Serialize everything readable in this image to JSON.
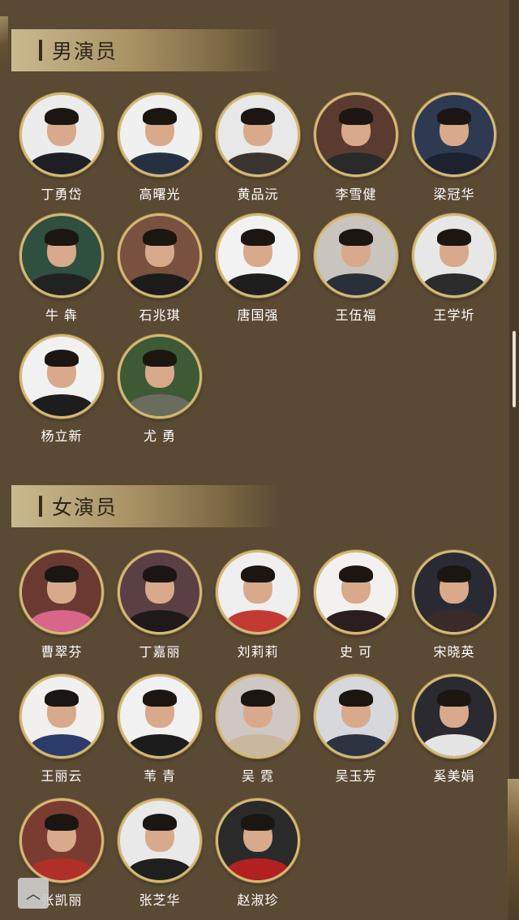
{
  "sections": [
    {
      "title": "男演员",
      "people": [
        {
          "name": "丁勇岱",
          "bg": "#ececec",
          "shirt": "#1d1f24"
        },
        {
          "name": "高曙光",
          "bg": "#f0f0f0",
          "shirt": "#263041"
        },
        {
          "name": "黄品沅",
          "bg": "#e8e8e8",
          "shirt": "#3a3530"
        },
        {
          "name": "李雪健",
          "bg": "#5b3a30",
          "shirt": "#2a2a2a"
        },
        {
          "name": "梁冠华",
          "bg": "#2e3a52",
          "shirt": "#1c2230"
        },
        {
          "name": "牛 犇",
          "bg": "#2f4f3f",
          "shirt": "#222"
        },
        {
          "name": "石兆琪",
          "bg": "#7a5040",
          "shirt": "#1c1c1c"
        },
        {
          "name": "唐国强",
          "bg": "#f2f2f2",
          "shirt": "#1e1e1e"
        },
        {
          "name": "王伍福",
          "bg": "#c9c4be",
          "shirt": "#2b2f3a"
        },
        {
          "name": "王学圻",
          "bg": "#e7e7e7",
          "shirt": "#2c2c2c"
        },
        {
          "name": "杨立新",
          "bg": "#f1f1f1",
          "shirt": "#1d1d1d"
        },
        {
          "name": "尤 勇",
          "bg": "#3e5a34",
          "shirt": "#6a6d5e"
        }
      ]
    },
    {
      "title": "女演员",
      "people": [
        {
          "name": "曹翠芬",
          "bg": "#6a3a32",
          "shirt": "#d7668a"
        },
        {
          "name": "丁嘉丽",
          "bg": "#5a3f45",
          "shirt": "#1e1a1a"
        },
        {
          "name": "刘莉莉",
          "bg": "#f0efef",
          "shirt": "#c23a32"
        },
        {
          "name": "史 可",
          "bg": "#f3f1f0",
          "shirt": "#2a1e1e"
        },
        {
          "name": "宋晓英",
          "bg": "#2a2a32",
          "shirt": "#3a2a2a"
        },
        {
          "name": "王丽云",
          "bg": "#f2f0ef",
          "shirt": "#2c3c6a"
        },
        {
          "name": "苇 青",
          "bg": "#f1f1f1",
          "shirt": "#1c1c1c"
        },
        {
          "name": "吴 霓",
          "bg": "#cfc7c3",
          "shirt": "#c9b8a0"
        },
        {
          "name": "吴玉芳",
          "bg": "#d6d8dc",
          "shirt": "#2d3340"
        },
        {
          "name": "奚美娟",
          "bg": "#2a2a30",
          "shirt": "#e5e5e5"
        },
        {
          "name": "张凯丽",
          "bg": "#7a3c30",
          "shirt": "#b03028"
        },
        {
          "name": "张芝华",
          "bg": "#e9e9e9",
          "shirt": "#1f1f1f"
        },
        {
          "name": "赵淑珍",
          "bg": "#2a2a2a",
          "shirt": "#b32020"
        }
      ]
    }
  ],
  "back_to_top_icon": "chevron-up-icon",
  "back_to_top_glyph": "︿"
}
